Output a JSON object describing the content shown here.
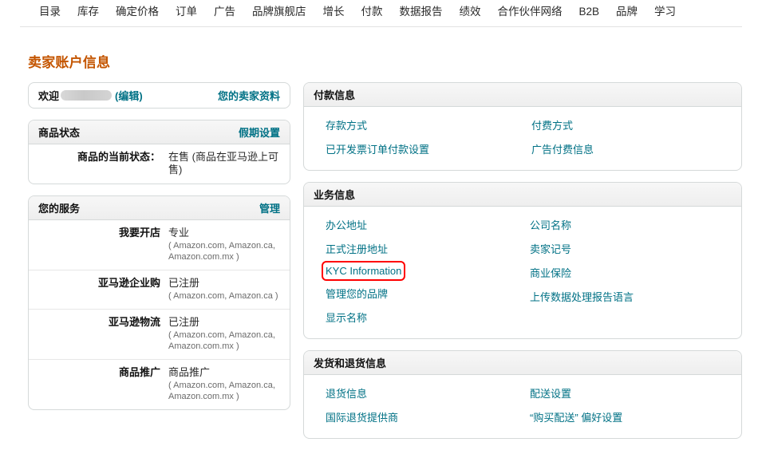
{
  "topnav": {
    "items": [
      {
        "label": "目录"
      },
      {
        "label": "库存"
      },
      {
        "label": "确定价格"
      },
      {
        "label": "订单"
      },
      {
        "label": "广告"
      },
      {
        "label": "品牌旗舰店"
      },
      {
        "label": "增长"
      },
      {
        "label": "付款"
      },
      {
        "label": "数据报告"
      },
      {
        "label": "绩效"
      },
      {
        "label": "合作伙伴网络"
      },
      {
        "label": "B2B"
      },
      {
        "label": "品牌"
      },
      {
        "label": "学习"
      }
    ]
  },
  "page": {
    "title": "卖家账户信息",
    "accent_color": "#c45500",
    "link_color": "#007185",
    "highlight_color": "#ff0000"
  },
  "welcome": {
    "greeting": "欢迎",
    "name_redacted": true,
    "edit_label": "(编辑)",
    "profile_link": "您的卖家资料"
  },
  "product_status": {
    "title": "商品状态",
    "header_link": "假期设置",
    "rows": [
      {
        "label": "商品的当前状态：",
        "value": "在售 (商品在亚马逊上可售)"
      }
    ]
  },
  "your_services": {
    "title": "您的服务",
    "header_link": "管理",
    "rows": [
      {
        "label": "我要开店",
        "value": "专业",
        "markets": "( Amazon.com, Amazon.ca, Amazon.com.mx )"
      },
      {
        "label": "亚马逊企业购",
        "value": "已注册",
        "markets": "( Amazon.com, Amazon.ca )"
      },
      {
        "label": "亚马逊物流",
        "value": "已注册",
        "markets": "( Amazon.com, Amazon.ca, Amazon.com.mx )"
      },
      {
        "label": "商品推广",
        "value": "商品推广",
        "markets": "( Amazon.com, Amazon.ca, Amazon.com.mx )"
      }
    ]
  },
  "payment_info": {
    "title": "付款信息",
    "column1": [
      {
        "label": "存款方式"
      },
      {
        "label": "已开发票订单付款设置"
      }
    ],
    "column2": [
      {
        "label": "付费方式"
      },
      {
        "label": "广告付费信息"
      }
    ]
  },
  "business_info": {
    "title": "业务信息",
    "column1": [
      {
        "label": "办公地址"
      },
      {
        "label": "正式注册地址"
      },
      {
        "label": "KYC Information"
      },
      {
        "label": "管理您的品牌"
      },
      {
        "label": "显示名称"
      }
    ],
    "column2": [
      {
        "label": "公司名称"
      },
      {
        "label": "卖家记号"
      },
      {
        "label": "商业保险"
      },
      {
        "label": "上传数据处理报告语言"
      }
    ]
  },
  "shipping_returns": {
    "title": "发货和退货信息",
    "column1": [
      {
        "label": "退货信息"
      },
      {
        "label": "国际退货提供商"
      }
    ],
    "column2": [
      {
        "label": "配送设置"
      },
      {
        "label": "“购买配送” 偏好设置"
      }
    ]
  }
}
